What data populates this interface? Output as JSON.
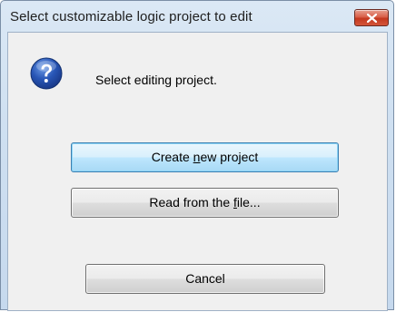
{
  "window": {
    "title": "Select customizable logic project to edit"
  },
  "dialog": {
    "icon": "question-icon",
    "message": "Select editing project."
  },
  "buttons": {
    "create": {
      "before": "Create ",
      "mnemonic": "n",
      "after": "ew project"
    },
    "read": {
      "before": "Read from the ",
      "mnemonic": "f",
      "after": "ile..."
    },
    "cancel": {
      "label": "Cancel"
    }
  },
  "colors": {
    "titlebar": "#cfe0f1",
    "close_button": "#d3553a",
    "client_bg": "#f0f0f0",
    "default_button_border": "#3c7fb1"
  }
}
